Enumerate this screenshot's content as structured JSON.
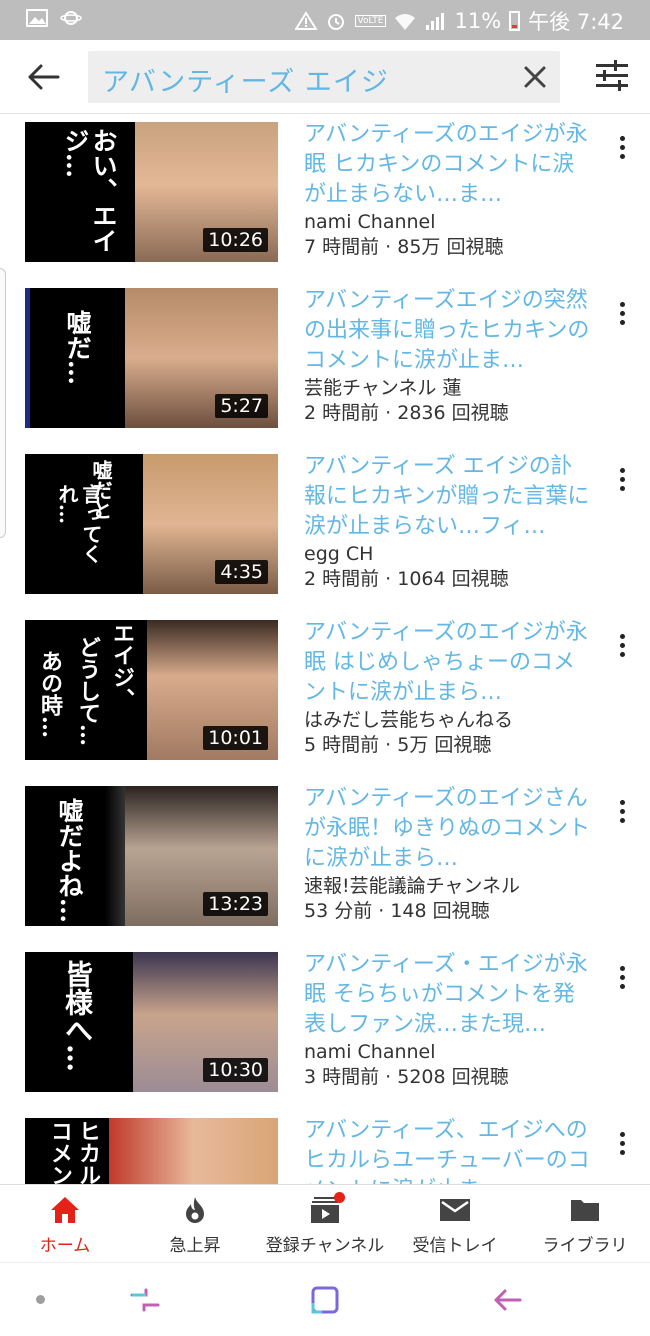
{
  "status_bar": {
    "battery_percent": "11%",
    "time": "午後 7:42",
    "network_label": "VoLTE"
  },
  "search": {
    "query": "アバンティーズ エイジ"
  },
  "videos": [
    {
      "title": "アバンティーズのエイジが永眠 ヒカキンのコメントに涙が止まらない…ま…",
      "channel": "nami Channel",
      "stats": "7 時間前 · 85万 回視聴",
      "duration": "10:26",
      "thumb_text": "おい、エイジ…"
    },
    {
      "title": "アバンティーズエイジの突然の出来事に贈ったヒカキンのコメントに涙が止ま…",
      "channel": "芸能チャンネル 蓮",
      "stats": "2 時間前 · 2836 回視聴",
      "duration": "5:27",
      "thumb_text": "嘘だ…"
    },
    {
      "title": "アバンティーズ エイジの訃報にヒカキンが贈った言葉に涙が止まらない…フィ…",
      "channel": "egg CH",
      "stats": "2 時間前 · 1064 回視聴",
      "duration": "4:35",
      "thumb_text_a": "嘘だと",
      "thumb_text_b": "言ってくれ…"
    },
    {
      "title": "アバンティーズのエイジが永眠 はじめしゃちょーのコメントに涙が止まら…",
      "channel": "はみだし芸能ちゃんねる",
      "stats": "5 時間前 · 5万 回視聴",
      "duration": "10:01",
      "thumb_text_a": "エイジ、",
      "thumb_text_b": "どうして…",
      "thumb_text_c": "あの時…"
    },
    {
      "title": "アバンティーズのエイジさんが永眠！ゆきりぬのコメントに涙が止まら…",
      "channel": "速報!芸能議論チャンネル",
      "stats": "53 分前 · 148 回視聴",
      "duration": "13:23",
      "thumb_text": "嘘だよね…"
    },
    {
      "title": "アバンティーズ・エイジが永眠 そらちぃがコメントを発表しファン涙…また現…",
      "channel": "nami Channel",
      "stats": "3 時間前 · 5208 回視聴",
      "duration": "10:30",
      "thumb_text": "皆様へ…"
    },
    {
      "title": "アバンティーズ、エイジへのヒカルらユーチューバーのコメントに涙が止ま…",
      "channel": "",
      "stats": "",
      "duration": "",
      "thumb_text_a": "ヒカル",
      "thumb_text_b": "コメン"
    }
  ],
  "bottom_nav": [
    {
      "label": "ホーム",
      "icon": "home-icon",
      "active": true
    },
    {
      "label": "急上昇",
      "icon": "flame-icon"
    },
    {
      "label": "登録チャンネル",
      "icon": "subscriptions-icon",
      "badge": true
    },
    {
      "label": "受信トレイ",
      "icon": "inbox-mail-icon"
    },
    {
      "label": "ライブラリ",
      "icon": "folder-icon"
    }
  ],
  "colors": {
    "title_blue": "#62b7e4",
    "accent_red": "#e62117",
    "statusbar_gray": "#bdbdbd"
  }
}
